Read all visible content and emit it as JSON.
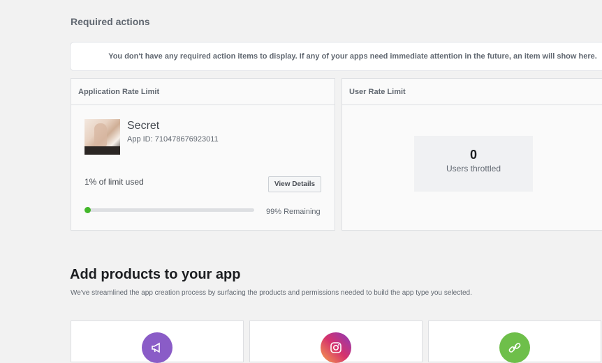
{
  "required_actions": {
    "title": "Required actions",
    "notice": "You don't have any required action items to display. If any of your apps need immediate attention in the future, an item will show here."
  },
  "app_rate_limit": {
    "title": "Application Rate Limit",
    "app_name": "Secret",
    "app_id": "App ID: 710478676923011",
    "limit_used": "1% of limit used",
    "view_details_label": "View Details",
    "progress_percent": 1,
    "remaining": "99% Remaining",
    "progress_color": "#42b72a"
  },
  "user_rate_limit": {
    "title": "User Rate Limit",
    "throttled_count": "0",
    "throttled_label": "Users throttled"
  },
  "add_products": {
    "title": "Add products to your app",
    "subtitle": "We've streamlined the app creation process by surfacing the products and permissions needed to build the app type you selected.",
    "products": [
      {
        "icon": "megaphone-icon",
        "color": "#8a5cc7"
      },
      {
        "icon": "instagram-icon",
        "color": "#d6336c"
      },
      {
        "icon": "link-icon",
        "color": "#6ebf4a"
      }
    ]
  }
}
